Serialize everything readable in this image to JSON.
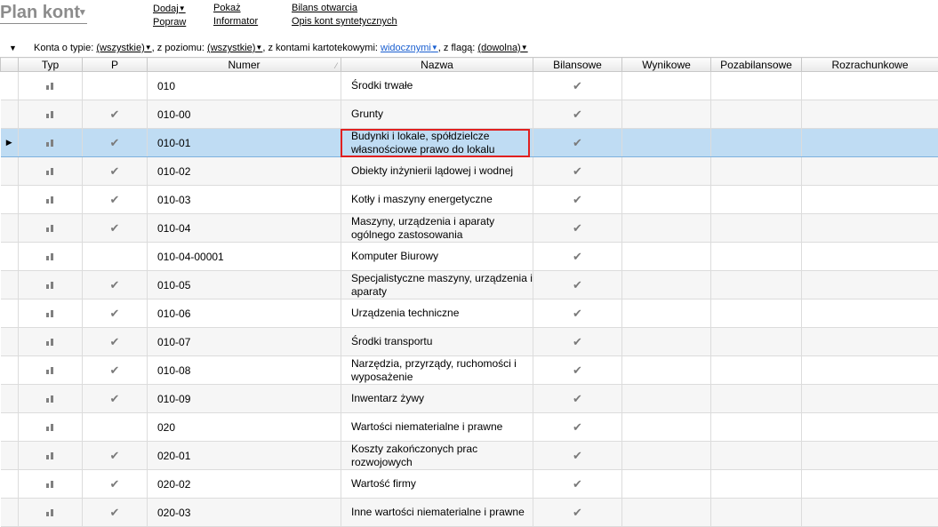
{
  "title": "Plan kont",
  "title_arrow": "▾",
  "menu": {
    "col1": [
      "Dodaj",
      "Popraw"
    ],
    "col2": [
      "Pokaż",
      "Informator"
    ],
    "col3": [
      "Bilans otwarcia",
      "Opis kont syntetycznych"
    ]
  },
  "filters": {
    "typ_label": "Konta o typie:",
    "typ_value": "(wszystkie)",
    "poziom_label": ", z poziomu:",
    "poziom_value": "(wszystkie)",
    "kart_label": ", z kontami kartotekowymi:",
    "kart_value": "widocznymi",
    "flaga_label": ", z flagą:",
    "flaga_value": "(dowolna)"
  },
  "columns": {
    "typ": "Typ",
    "p": "P",
    "numer": "Numer",
    "nazwa": "Nazwa",
    "bilansowe": "Bilansowe",
    "wynikowe": "Wynikowe",
    "pozabilansowe": "Pozabilansowe",
    "rozrachunkowe": "Rozrachunkowe"
  },
  "rows": [
    {
      "p": false,
      "numer": "010",
      "nazwa": "Środki trwałe",
      "bil": true
    },
    {
      "p": true,
      "numer": "010-00",
      "nazwa": "Grunty",
      "bil": true
    },
    {
      "p": true,
      "numer": "010-01",
      "nazwa": "Budynki i lokale, spółdzielcze własnościowe prawo do lokalu",
      "bil": true,
      "selected": true
    },
    {
      "p": true,
      "numer": "010-02",
      "nazwa": "Obiekty inżynierii lądowej i wodnej",
      "bil": true
    },
    {
      "p": true,
      "numer": "010-03",
      "nazwa": "Kotły i maszyny energetyczne",
      "bil": true
    },
    {
      "p": true,
      "numer": "010-04",
      "nazwa": "Maszyny, urządzenia i aparaty ogólnego zastosowania",
      "bil": true
    },
    {
      "p": false,
      "numer": "010-04-00001",
      "nazwa": "Komputer Biurowy",
      "bil": true
    },
    {
      "p": true,
      "numer": "010-05",
      "nazwa": "Specjalistyczne maszyny, urządzenia i aparaty",
      "bil": true
    },
    {
      "p": true,
      "numer": "010-06",
      "nazwa": "Urządzenia techniczne",
      "bil": true
    },
    {
      "p": true,
      "numer": "010-07",
      "nazwa": "Środki transportu",
      "bil": true
    },
    {
      "p": true,
      "numer": "010-08",
      "nazwa": "Narzędzia, przyrządy, ruchomości i wyposażenie",
      "bil": true
    },
    {
      "p": true,
      "numer": "010-09",
      "nazwa": "Inwentarz żywy",
      "bil": true
    },
    {
      "p": false,
      "numer": "020",
      "nazwa": "Wartości niematerialne i prawne",
      "bil": true
    },
    {
      "p": true,
      "numer": "020-01",
      "nazwa": "Koszty zakończonych prac rozwojowych",
      "bil": true
    },
    {
      "p": true,
      "numer": "020-02",
      "nazwa": "Wartość firmy",
      "bil": true
    },
    {
      "p": true,
      "numer": "020-03",
      "nazwa": "Inne wartości niematerialne i prawne",
      "bil": true
    }
  ],
  "icons": {
    "check": "✔",
    "type": "bar-chart-icon",
    "current_row": "▶",
    "dropdown": "▼"
  }
}
